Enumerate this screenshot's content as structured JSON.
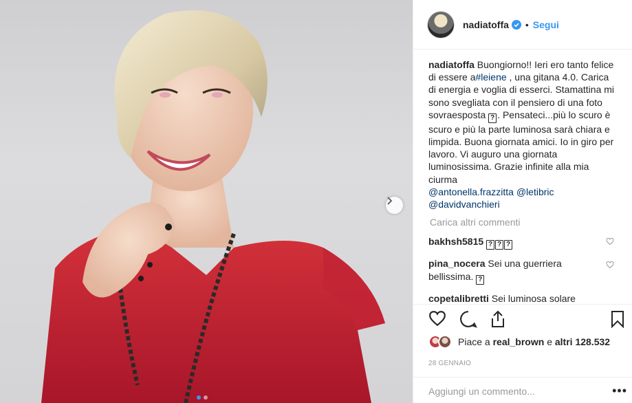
{
  "post": {
    "username": "nadiatoffa",
    "verified": true,
    "separator": "•",
    "follow_label": "Segui",
    "caption_user": "nadiatoffa",
    "caption_lines": [
      "Buongiorno!! Ieri ero tanto",
      "felice di essere a",
      "Carica di energia e voglia di esserci.",
      "Stamattina mi sono svegliata con il",
      "pensiero di una foto sovraesposta",
      "Pensateci...più lo scuro è scuro e più la",
      "parte luminosa sarà chiara e limpida.",
      "Buona giornata amici. Io in giro per lavoro.",
      "Vi auguro una giornata luminosissima.",
      "Grazie infinite alla mia ciurma"
    ],
    "caption_hashtag": "#leiene",
    "caption_after_hashtag": " , una gitana 4.0.",
    "mentions": [
      "@antonella.frazzitta",
      "@letibric",
      "@davidvanchieri"
    ],
    "emoji_placeholder": "?",
    "load_more_label": "Carica altri commenti",
    "comments": [
      {
        "user": "bakhsh5815",
        "text": ""
      },
      {
        "user": "pina_nocera",
        "text": "Sei una guerriera bellissima."
      },
      {
        "user": "copetalibretti",
        "text": "Sei luminosa solare allegra piena di vita c'è la farai ne"
      }
    ],
    "likes_prefix": "Piace a",
    "likes_user": "real_brown",
    "likes_mid": "e",
    "likes_count": "altri 128.532",
    "date": "28 GENNAIO",
    "add_comment_placeholder": "Aggiungi un commento...",
    "more_icon": "•••"
  },
  "icons": {
    "verified": "verified-badge-icon",
    "next": "chevron-right-icon",
    "like": "heart-icon",
    "comment": "comment-icon",
    "share": "share-icon",
    "save": "bookmark-icon"
  },
  "colors": {
    "accent": "#3897f0",
    "link": "#003569",
    "muted": "#999999",
    "text": "#262626"
  },
  "carousel": {
    "total_slides": 2,
    "active_slide": 1
  }
}
